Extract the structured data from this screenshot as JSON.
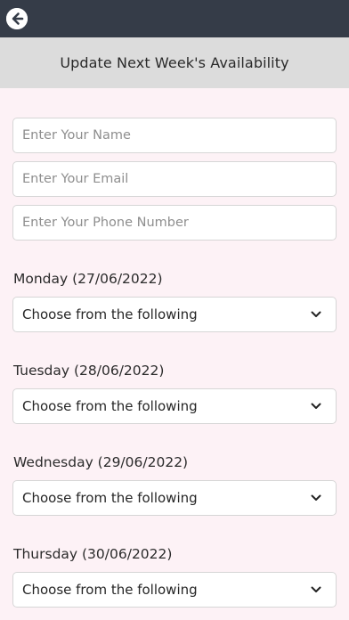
{
  "header": {
    "back_icon": "arrow-left-circle-icon",
    "title": "Update Next Week's Availability"
  },
  "form": {
    "name_placeholder": "Enter Your Name",
    "email_placeholder": "Enter Your Email",
    "phone_placeholder": "Enter Your Phone Number"
  },
  "days": [
    {
      "label": "Monday (27/06/2022)",
      "selected": "Choose from the following"
    },
    {
      "label": "Tuesday (28/06/2022)",
      "selected": "Choose from the following"
    },
    {
      "label": "Wednesday (29/06/2022)",
      "selected": "Choose from the following"
    },
    {
      "label": "Thursday (30/06/2022)",
      "selected": "Choose from the following"
    }
  ],
  "colors": {
    "topbar": "#353c48",
    "subheader": "#dcdcdc",
    "background": "#fdf2f6"
  }
}
